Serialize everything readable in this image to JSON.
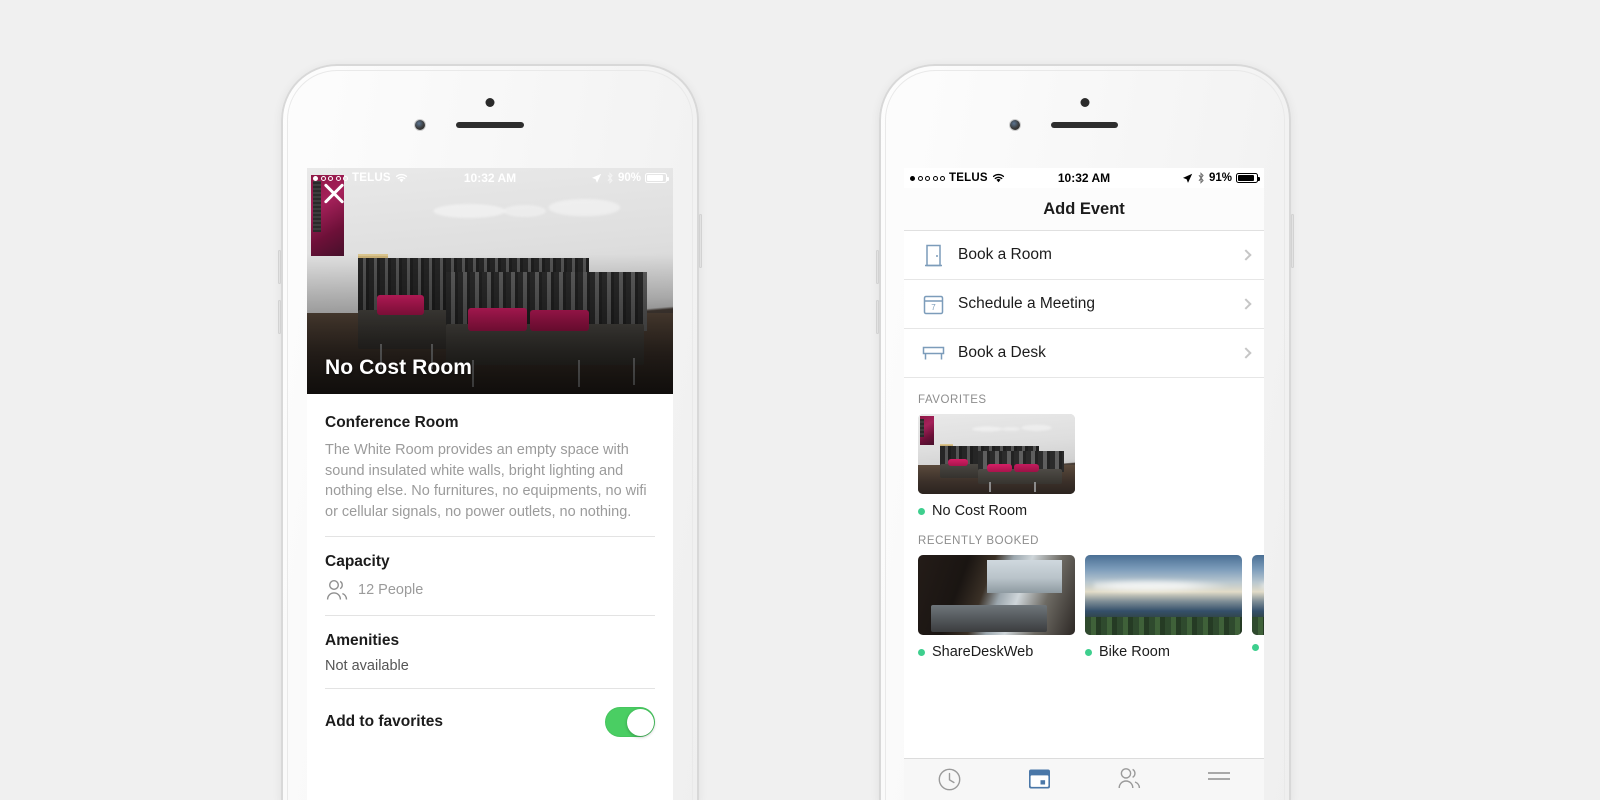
{
  "background_color": "#f0f0f0",
  "accent_colors": {
    "toggle_green": "#4ace63",
    "status_dot_green": "#3ecf8e",
    "icon_blue": "#6f8fb0",
    "tab_active_blue": "#4a77a8",
    "muted_text": "#9b9b9b"
  },
  "left_phone": {
    "status_bar": {
      "carrier": "TELUS",
      "signal_dots_filled": 1,
      "signal_dots_total": 5,
      "wifi_icon": "wifi-icon",
      "time": "10:32 AM",
      "location_icon": "location-arrow-icon",
      "bluetooth_icon": "bluetooth-icon",
      "battery_percent": "90%",
      "battery_level": 90
    },
    "hero": {
      "close_icon": "close-icon",
      "room_title": "No Cost Room",
      "image_alt": "office-lounge-photo"
    },
    "details": {
      "type_heading": "Conference Room",
      "description": "The White Room provides an empty space with sound insulated white walls, bright lighting and nothing else.  No furnitures, no equipments, no wifi or cellular signals, no power outlets, no nothing.",
      "capacity_heading": "Capacity",
      "capacity_icon": "people-icon",
      "capacity_value": "12 People",
      "amenities_heading": "Amenities",
      "amenities_value": "Not available",
      "favorites_label": "Add to favorites",
      "favorites_toggle_on": true
    }
  },
  "right_phone": {
    "status_bar": {
      "carrier": "TELUS",
      "signal_dots_filled": 1,
      "signal_dots_total": 5,
      "wifi_icon": "wifi-icon",
      "time": "10:32 AM",
      "location_icon": "location-arrow-icon",
      "bluetooth_icon": "bluetooth-icon",
      "battery_percent": "91%",
      "battery_level": 91
    },
    "navbar": {
      "title": "Add Event"
    },
    "menu_items": [
      {
        "label": "Book a Room",
        "icon": "door-icon",
        "chevron": "chevron-right-icon"
      },
      {
        "label": "Schedule a Meeting",
        "icon": "calendar-icon",
        "icon_day": "7",
        "chevron": "chevron-right-icon"
      },
      {
        "label": "Book a Desk",
        "icon": "desk-icon",
        "chevron": "chevron-right-icon"
      }
    ],
    "favorites": {
      "title": "FAVORITES",
      "cards": [
        {
          "name": "No Cost Room",
          "status": "available",
          "thumb": "office-lounge-photo"
        }
      ]
    },
    "recently_booked": {
      "title": "RECENTLY BOOKED",
      "cards": [
        {
          "name": "ShareDeskWeb",
          "status": "available",
          "thumb": "desk-workspace-photo"
        },
        {
          "name": "Bike Room",
          "status": "available",
          "thumb": "sky-landscape-photo"
        },
        {
          "name": "",
          "status": "available",
          "thumb": "sky-landscape-photo-partial"
        }
      ]
    },
    "tab_bar": [
      {
        "name": "recent",
        "icon": "clock-icon",
        "active": false
      },
      {
        "name": "calendar",
        "icon": "calendar-filled-icon",
        "active": true
      },
      {
        "name": "people",
        "icon": "people-icon",
        "active": false
      },
      {
        "name": "more",
        "icon": "hamburger-menu-icon",
        "active": false
      }
    ]
  }
}
